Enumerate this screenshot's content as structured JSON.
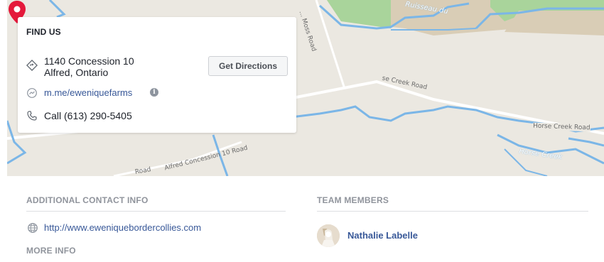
{
  "map": {
    "road_labels": {
      "moss_road": "... Moss Road",
      "horse_creek_near_pin": "se Creek Road",
      "horse_creek_right": "Horse Creek Road",
      "alfred_concession": "Alfred Concession 10 Road",
      "road_fragment": "Road"
    },
    "water_labels": {
      "ruisseau": "Ruisseau du",
      "horse_creek": "Horse Creek"
    },
    "colors": {
      "land": "#ebe8e1",
      "water": "#7bb6e7",
      "park": "#a9d49b",
      "road": "#ffffff",
      "pin": "#e4193b"
    }
  },
  "find_us": {
    "title": "FIND US",
    "address_line1": "1140 Concession 10",
    "address_line2": "Alfred, Ontario",
    "directions_button": "Get Directions",
    "messenger_link": "m.me/eweniquefarms",
    "info_glyph": "i",
    "phone": "Call (613) 290-5405"
  },
  "additional_contact": {
    "title": "ADDITIONAL CONTACT INFO",
    "website": "http://www.eweniquebordercollies.com"
  },
  "more_info": {
    "title": "MORE INFO"
  },
  "team": {
    "title": "TEAM MEMBERS",
    "members": [
      {
        "name": "Nathalie Labelle"
      }
    ]
  }
}
